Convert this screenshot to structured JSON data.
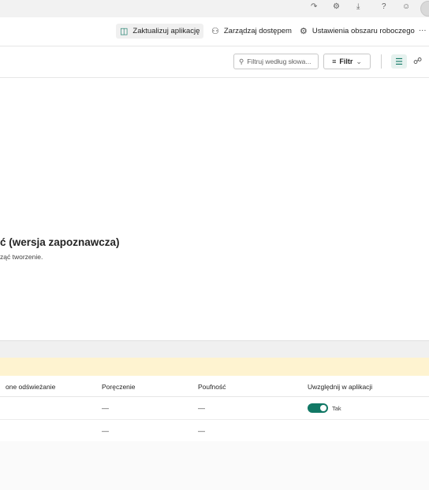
{
  "topbar": {
    "icons": [
      "notifications-icon",
      "settings-icon",
      "download-icon",
      "help-icon",
      "feedback-icon"
    ],
    "glyphs": [
      "↷",
      "⚙",
      "⤓",
      "?",
      "☺"
    ]
  },
  "appbar": {
    "update_app": "Zaktualizuj aplikację",
    "manage_access": "Zarządzaj dostępem",
    "workspace_settings": "Ustawienia obszaru roboczego",
    "more": "···"
  },
  "cmdbar": {
    "search_placeholder": "Filtruj według słowa...",
    "filter_label": "Filtr",
    "filter_chevron": "⌄"
  },
  "empty_state": {
    "title": "ć (wersja zapoznawcza)",
    "subtitle": "ząć tworzenie."
  },
  "table": {
    "columns": [
      "one odświeżanie",
      "Poręczenie",
      "Poufność",
      "Uwzględnij w aplikacji"
    ],
    "rows": [
      {
        "endorsement": "—",
        "sensitivity": "—",
        "include": true,
        "include_label": "Tak"
      },
      {
        "endorsement": "—",
        "sensitivity": "—",
        "include": false,
        "include_label": ""
      }
    ]
  },
  "colors": {
    "accent": "#117865",
    "warning_band": "#fef3d0"
  }
}
